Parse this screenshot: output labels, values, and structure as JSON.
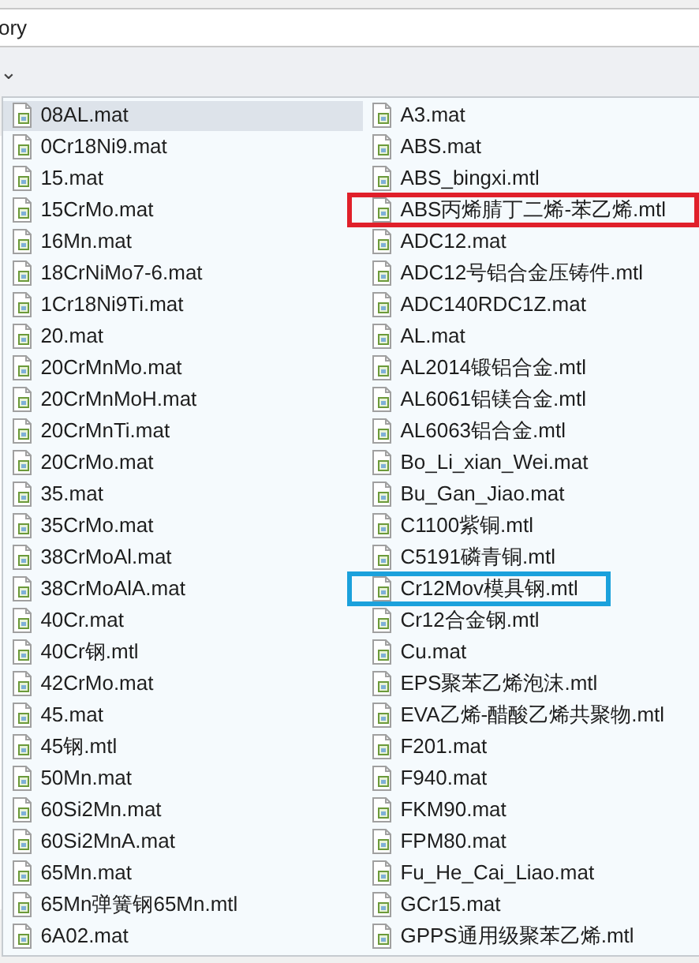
{
  "address_bar": {
    "value": "ory"
  },
  "toolbar": {
    "chevron": "⌄"
  },
  "files": [
    {
      "name": "08AL.mat",
      "selected": true
    },
    {
      "name": "0Cr18Ni9.mat",
      "selected": false
    },
    {
      "name": "15.mat",
      "selected": false
    },
    {
      "name": "15CrMo.mat",
      "selected": false
    },
    {
      "name": "16Mn.mat",
      "selected": false
    },
    {
      "name": "18CrNiMo7-6.mat",
      "selected": false
    },
    {
      "name": "1Cr18Ni9Ti.mat",
      "selected": false
    },
    {
      "name": "20.mat",
      "selected": false
    },
    {
      "name": "20CrMnMo.mat",
      "selected": false
    },
    {
      "name": "20CrMnMoH.mat",
      "selected": false
    },
    {
      "name": "20CrMnTi.mat",
      "selected": false
    },
    {
      "name": "20CrMo.mat",
      "selected": false
    },
    {
      "name": "35.mat",
      "selected": false
    },
    {
      "name": "35CrMo.mat",
      "selected": false
    },
    {
      "name": "38CrMoAl.mat",
      "selected": false
    },
    {
      "name": "38CrMoAlA.mat",
      "selected": false
    },
    {
      "name": "40Cr.mat",
      "selected": false
    },
    {
      "name": "40Cr钢.mtl",
      "selected": false
    },
    {
      "name": "42CrMo.mat",
      "selected": false
    },
    {
      "name": "45.mat",
      "selected": false
    },
    {
      "name": "45钢.mtl",
      "selected": false
    },
    {
      "name": "50Mn.mat",
      "selected": false
    },
    {
      "name": "60Si2Mn.mat",
      "selected": false
    },
    {
      "name": "60Si2MnA.mat",
      "selected": false
    },
    {
      "name": "65Mn.mat",
      "selected": false
    },
    {
      "name": "65Mn弹簧钢65Mn.mtl",
      "selected": false
    },
    {
      "name": "6A02.mat",
      "selected": false
    },
    {
      "name": "A3.mat",
      "selected": false
    },
    {
      "name": "ABS.mat",
      "selected": false
    },
    {
      "name": "ABS_bingxi.mtl",
      "selected": false
    },
    {
      "name": "ABS丙烯腈丁二烯-苯乙烯.mtl",
      "selected": false,
      "color": "#e0202a"
    },
    {
      "name": "ADC12.mat",
      "selected": false
    },
    {
      "name": "ADC12号铝合金压铸件.mtl",
      "selected": false
    },
    {
      "name": "ADC140RDC1Z.mat",
      "selected": false
    },
    {
      "name": "AL.mat",
      "selected": false
    },
    {
      "name": "AL2014锻铝合金.mtl",
      "selected": false
    },
    {
      "name": "AL6061铝镁合金.mtl",
      "selected": false
    },
    {
      "name": "AL6063铝合金.mtl",
      "selected": false
    },
    {
      "name": "Bo_Li_xian_Wei.mat",
      "selected": false
    },
    {
      "name": "Bu_Gan_Jiao.mat",
      "selected": false
    },
    {
      "name": "C1100紫铜.mtl",
      "selected": false
    },
    {
      "name": "C5191磷青铜.mtl",
      "selected": false
    },
    {
      "name": "Cr12Mov模具钢.mtl",
      "selected": false,
      "color": "#1ba1dc"
    },
    {
      "name": "Cr12合金钢.mtl",
      "selected": false
    },
    {
      "name": "Cu.mat",
      "selected": false
    },
    {
      "name": "EPS聚苯乙烯泡沫.mtl",
      "selected": false
    },
    {
      "name": "EVA乙烯-醋酸乙烯共聚物.mtl",
      "selected": false
    },
    {
      "name": "F201.mat",
      "selected": false
    },
    {
      "name": "F940.mat",
      "selected": false
    },
    {
      "name": "FKM90.mat",
      "selected": false
    },
    {
      "name": "FPM80.mat",
      "selected": false
    },
    {
      "name": "Fu_He_Cai_Liao.mat",
      "selected": false
    },
    {
      "name": "GCr15.mat",
      "selected": false
    },
    {
      "name": "GPPS通用级聚苯乙烯.mtl",
      "selected": false
    }
  ]
}
